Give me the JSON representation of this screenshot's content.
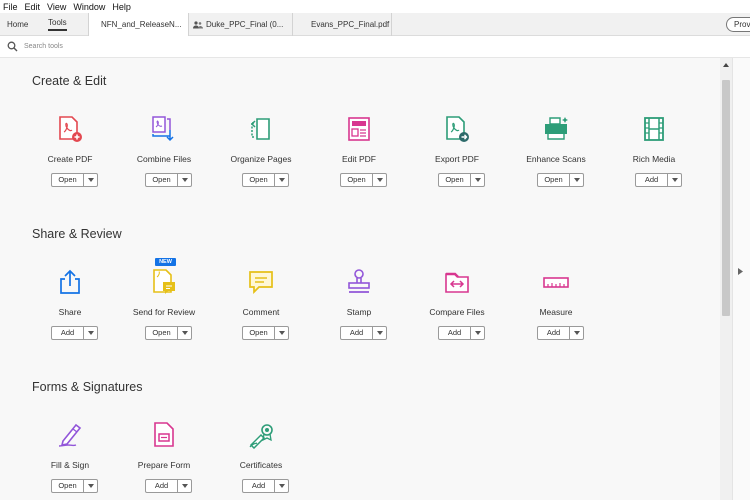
{
  "menubar": {
    "items": [
      "File",
      "Edit",
      "View",
      "Window",
      "Help"
    ]
  },
  "tabs": {
    "home": "Home",
    "tools": "Tools",
    "docs": [
      "NFN_and_ReleaseN...",
      "Duke_PPC_Final (0...",
      "Evans_PPC_Final.pdf"
    ],
    "provide": "Provi"
  },
  "search": {
    "placeholder": "Search tools"
  },
  "sections": {
    "create_edit": "Create & Edit",
    "share_review": "Share & Review",
    "forms_signatures": "Forms & Signatures"
  },
  "tools": {
    "create_pdf": {
      "label": "Create PDF",
      "action": "Open"
    },
    "combine_files": {
      "label": "Combine Files",
      "action": "Open"
    },
    "organize_pages": {
      "label": "Organize Pages",
      "action": "Open"
    },
    "edit_pdf": {
      "label": "Edit PDF",
      "action": "Open"
    },
    "export_pdf": {
      "label": "Export PDF",
      "action": "Open"
    },
    "enhance_scans": {
      "label": "Enhance Scans",
      "action": "Open"
    },
    "rich_media": {
      "label": "Rich Media",
      "action": "Add"
    },
    "share": {
      "label": "Share",
      "action": "Add"
    },
    "send_for_review": {
      "label": "Send for Review",
      "action": "Open",
      "badge": "NEW"
    },
    "comment": {
      "label": "Comment",
      "action": "Open"
    },
    "stamp": {
      "label": "Stamp",
      "action": "Add"
    },
    "compare_files": {
      "label": "Compare Files",
      "action": "Add"
    },
    "measure": {
      "label": "Measure",
      "action": "Add"
    },
    "fill_sign": {
      "label": "Fill & Sign",
      "action": "Open"
    },
    "prepare_form": {
      "label": "Prepare Form",
      "action": "Add"
    },
    "certificates": {
      "label": "Certificates",
      "action": "Add"
    }
  },
  "colors": {
    "red": "#e34850",
    "blue": "#1473e6",
    "green": "#2d9d78",
    "pink": "#d83790",
    "yellow": "#e6c018",
    "purple": "#9256d9"
  }
}
